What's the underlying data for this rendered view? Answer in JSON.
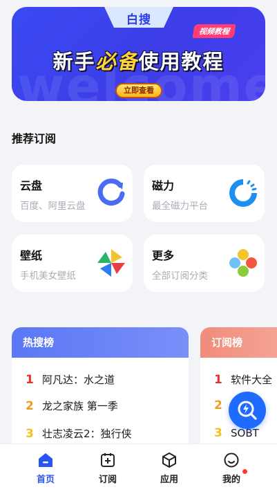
{
  "banner": {
    "logo": "白搜",
    "watermark": "welcome",
    "badge": "视频教程",
    "title_part1": "新手",
    "title_highlight": "必备",
    "title_part2": "使用教程",
    "cta": "立即查看",
    "colors": {
      "background": "#3a49f2",
      "highlight": "#ffd338",
      "badge": "#ff3d74"
    }
  },
  "section": {
    "title": "推荐订阅"
  },
  "cards": [
    {
      "title": "云盘",
      "subtitle": "百度、阿里云盘",
      "icon": "cloud-ring-icon"
    },
    {
      "title": "磁力",
      "subtitle": "最全磁力平台",
      "icon": "magnet-spinner-icon"
    },
    {
      "title": "壁纸",
      "subtitle": "手机美女壁纸",
      "icon": "pinwheel-icon"
    },
    {
      "title": "更多",
      "subtitle": "全部订阅分类",
      "icon": "four-dots-icon"
    }
  ],
  "rankings": [
    {
      "title": "热搜榜",
      "items": [
        {
          "rank": "1",
          "label": "阿凡达：水之道"
        },
        {
          "rank": "2",
          "label": "龙之家族 第一季"
        },
        {
          "rank": "3",
          "label": "壮志凌云2：独行侠"
        }
      ]
    },
    {
      "title": "订阅榜",
      "items": [
        {
          "rank": "1",
          "label": "软件大全"
        },
        {
          "rank": "2",
          "label": ""
        },
        {
          "rank": "3",
          "label": "SOBT"
        }
      ]
    }
  ],
  "fab": {
    "icon": "search-lightning-icon"
  },
  "nav": {
    "items": [
      {
        "label": "首页",
        "icon": "home-icon",
        "active": true
      },
      {
        "label": "订阅",
        "icon": "subscribe-icon",
        "active": false
      },
      {
        "label": "应用",
        "icon": "cube-icon",
        "active": false
      },
      {
        "label": "我的",
        "icon": "profile-icon",
        "active": false
      }
    ],
    "accent": "#2b54f5"
  }
}
